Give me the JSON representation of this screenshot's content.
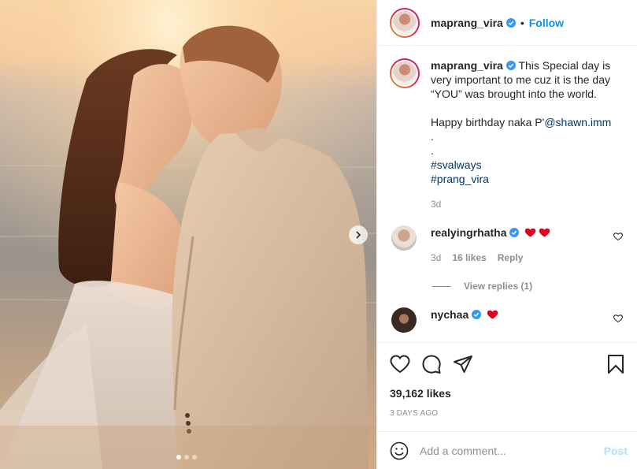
{
  "header": {
    "username": "maprang_vira",
    "separator": "•",
    "follow_label": "Follow"
  },
  "caption": {
    "username": "maprang_vira",
    "text_line1": "This Special day is very important to me cuz it is the day “YOU” was brought into the world.",
    "text_line2_prefix": "Happy birthday naka P'",
    "mention": "@shawn.imm",
    "dot1": ".",
    "dot2": ".",
    "hashtag1": "#svalways",
    "hashtag2": "#prang_vira",
    "time": "3d"
  },
  "comments": [
    {
      "username": "realyingrhatha",
      "time": "3d",
      "likes": "16 likes",
      "reply_label": "Reply"
    },
    {
      "username": "nychaa"
    }
  ],
  "view_replies": "View replies (1)",
  "post": {
    "likes": "39,162 likes",
    "date": "3 DAYS AGO"
  },
  "add_comment": {
    "placeholder": "Add a comment...",
    "post_label": "Post"
  },
  "colors": {
    "accent": "#0095f6",
    "heart": "#e0001b"
  },
  "icons": [
    "verified-badge-icon",
    "heart-icon",
    "comment-icon",
    "share-icon",
    "bookmark-icon",
    "emoji-icon",
    "chevron-right-icon"
  ]
}
